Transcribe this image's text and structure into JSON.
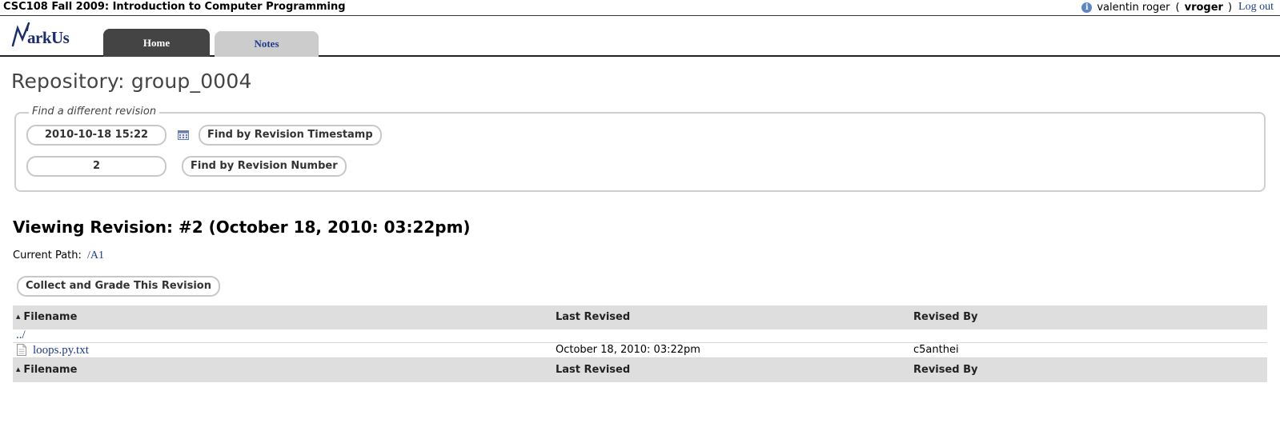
{
  "topbar": {
    "course_title": "CSC108 Fall 2009: Introduction to Computer Programming",
    "user_name": "valentin roger",
    "user_login": "vroger",
    "logout_label": "Log out",
    "info_icon": "info-icon"
  },
  "header": {
    "logo_text": "arkUs",
    "tabs": [
      {
        "label": "Home",
        "active": true
      },
      {
        "label": "Notes",
        "active": false
      }
    ]
  },
  "page": {
    "title": "Repository: group_0004",
    "find_legend": "Find a different revision",
    "timestamp_value": "2010-10-18 15:22",
    "find_by_timestamp_label": "Find by Revision Timestamp",
    "revision_number_value": "2",
    "find_by_number_label": "Find by Revision Number",
    "viewing_revision": "Viewing Revision: #2 (October 18, 2010: 03:22pm)",
    "current_path_label": "Current Path:",
    "current_path_value": "/A1",
    "collect_button_label": "Collect and Grade This Revision"
  },
  "table": {
    "columns": [
      "Filename",
      "Last Revised",
      "Revised By"
    ],
    "parent_link": "../",
    "rows": [
      {
        "filename": "loops.py.txt",
        "last_revised": "October 18, 2010: 03:22pm",
        "revised_by": "c5anthei"
      }
    ]
  },
  "colors": {
    "link": "#1f3b8c",
    "active_tab": "#444444",
    "inactive_tab": "#cccccc",
    "table_header": "#dedede"
  }
}
